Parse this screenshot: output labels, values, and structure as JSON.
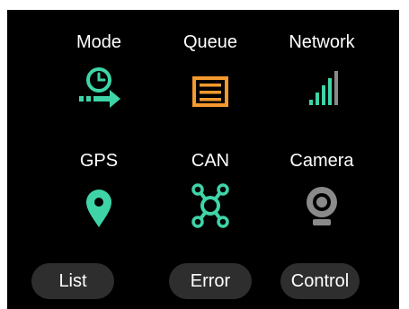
{
  "tiles": {
    "mode": "Mode",
    "queue": "Queue",
    "network": "Network",
    "gps": "GPS",
    "can": "CAN",
    "camera": "Camera"
  },
  "icons": {
    "mode": "clock-arrow-icon",
    "queue": "list-box-icon",
    "network": "signal-bars-icon",
    "gps": "location-pin-icon",
    "can": "network-nodes-icon",
    "camera": "webcam-icon"
  },
  "buttons": {
    "list": "List",
    "error": "Error",
    "control": "Control"
  },
  "colors": {
    "accent_green": "#3fd4a8",
    "accent_orange": "#f59a2e",
    "gray": "#8a8a8a",
    "button_bg": "#2e2e2e",
    "background": "#000000"
  }
}
